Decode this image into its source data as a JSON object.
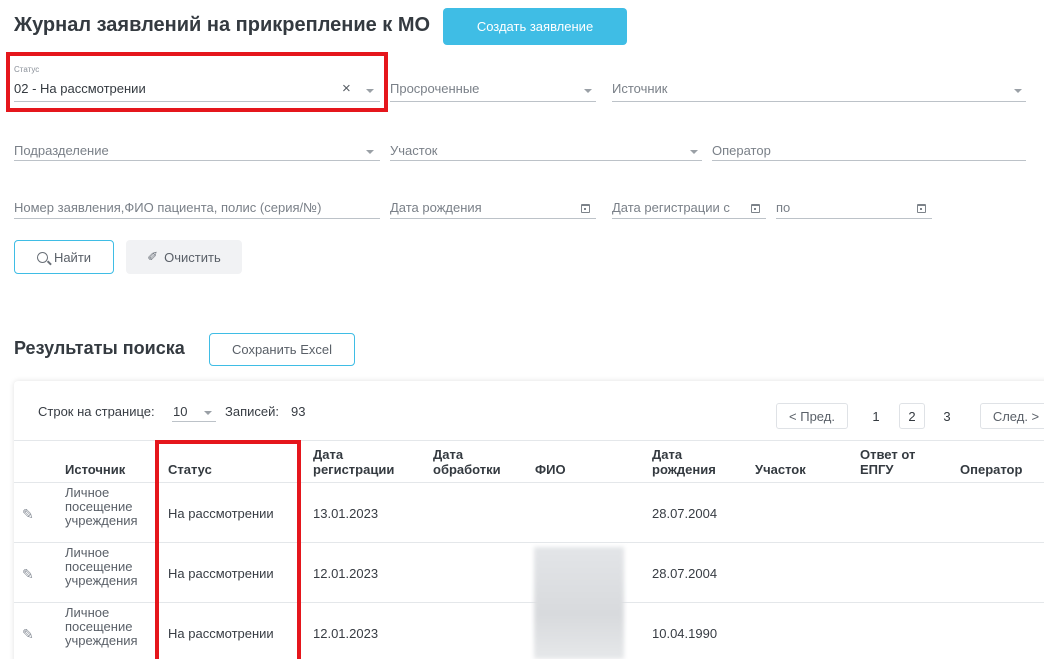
{
  "header": {
    "title": "Журнал заявлений на прикрепление к МО",
    "create_button": "Создать заявление"
  },
  "filters": {
    "status": {
      "label": "Статус",
      "value": "02 - На рассмотрении"
    },
    "overdue": {
      "placeholder": "Просроченные"
    },
    "source": {
      "placeholder": "Источник"
    },
    "department": {
      "placeholder": "Подразделение"
    },
    "district": {
      "placeholder": "Участок"
    },
    "operator": {
      "placeholder": "Оператор"
    },
    "query": {
      "placeholder": "Номер заявления,ФИО пациента, полис (серия/№)"
    },
    "birth_date": {
      "placeholder": "Дата рождения"
    },
    "reg_from": {
      "placeholder": "Дата регистрации с"
    },
    "reg_to": {
      "placeholder": "по"
    },
    "find_button": "Найти",
    "clear_button": "Очистить"
  },
  "results": {
    "title": "Результаты поиска",
    "excel_button": "Сохранить Excel",
    "rows_per_page_label": "Строк на странице:",
    "rows_per_page_value": "10",
    "records_label": "Записей:",
    "records_count": "93",
    "pagination": {
      "prev": "< Пред.",
      "pages": [
        "1",
        "2",
        "3"
      ],
      "current": "2",
      "next": "След. >"
    },
    "columns": {
      "source": "Источник",
      "status": "Статус",
      "reg_date_1": "Дата",
      "reg_date_2": "регистрации",
      "proc_date_1": "Дата",
      "proc_date_2": "обработки",
      "fio": "ФИО",
      "birth_1": "Дата",
      "birth_2": "рождения",
      "district": "Участок",
      "epgu_1": "Ответ от",
      "epgu_2": "ЕПГУ",
      "operator": "Оператор"
    },
    "rows": [
      {
        "source_1": "Личное",
        "source_2": "посещение",
        "source_3": "учреждения",
        "status": "На рассмотрении",
        "reg_date": "13.01.2023",
        "birth": "28.07.2004"
      },
      {
        "source_1": "Личное",
        "source_2": "посещение",
        "source_3": "учреждения",
        "status": "На рассмотрении",
        "reg_date": "12.01.2023",
        "birth": "28.07.2004"
      },
      {
        "source_1": "Личное",
        "source_2": "посещение",
        "source_3": "учреждения",
        "status": "На рассмотрении",
        "reg_date": "12.01.2023",
        "birth": "10.04.1990"
      }
    ]
  },
  "colors": {
    "accent": "#3fbde5",
    "highlight": "#e5161c"
  }
}
